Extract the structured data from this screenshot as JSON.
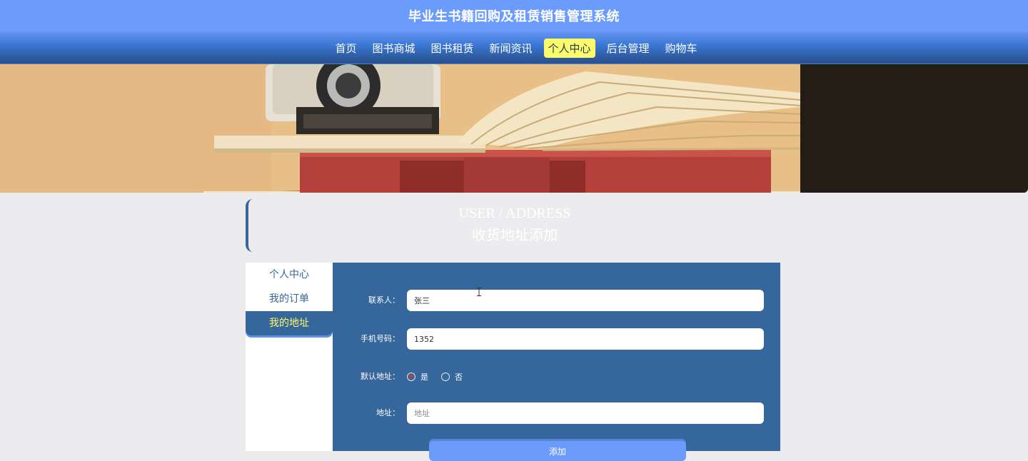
{
  "site": {
    "title": "毕业生书籍回购及租赁销售管理系统"
  },
  "nav": {
    "items": [
      {
        "label": "首页",
        "active": false
      },
      {
        "label": "图书商城",
        "active": false
      },
      {
        "label": "图书租赁",
        "active": false
      },
      {
        "label": "新闻资讯",
        "active": false
      },
      {
        "label": "个人中心",
        "active": true
      },
      {
        "label": "后台管理",
        "active": false
      },
      {
        "label": "购物车",
        "active": false
      }
    ]
  },
  "section": {
    "title_en": "USER / ADDRESS",
    "title_cn": "收货地址添加"
  },
  "sidebar": {
    "items": [
      {
        "label": "个人中心",
        "active": false
      },
      {
        "label": "我的订单",
        "active": false
      },
      {
        "label": "我的地址",
        "active": true
      }
    ]
  },
  "form": {
    "contact": {
      "label": "联系人：",
      "value": "张三"
    },
    "phone": {
      "label": "手机号码：",
      "value": "1352"
    },
    "default": {
      "label": "默认地址：",
      "options": [
        "是",
        "否"
      ],
      "selected": "是"
    },
    "address": {
      "label": "地址：",
      "value": "",
      "placeholder": "地址"
    },
    "submit_label": "添加"
  },
  "colors": {
    "header_bg": "#6b9cfc",
    "panel_bg": "#35669c",
    "active_nav_bg": "#fdfd6b",
    "page_bg": "#ececef"
  }
}
